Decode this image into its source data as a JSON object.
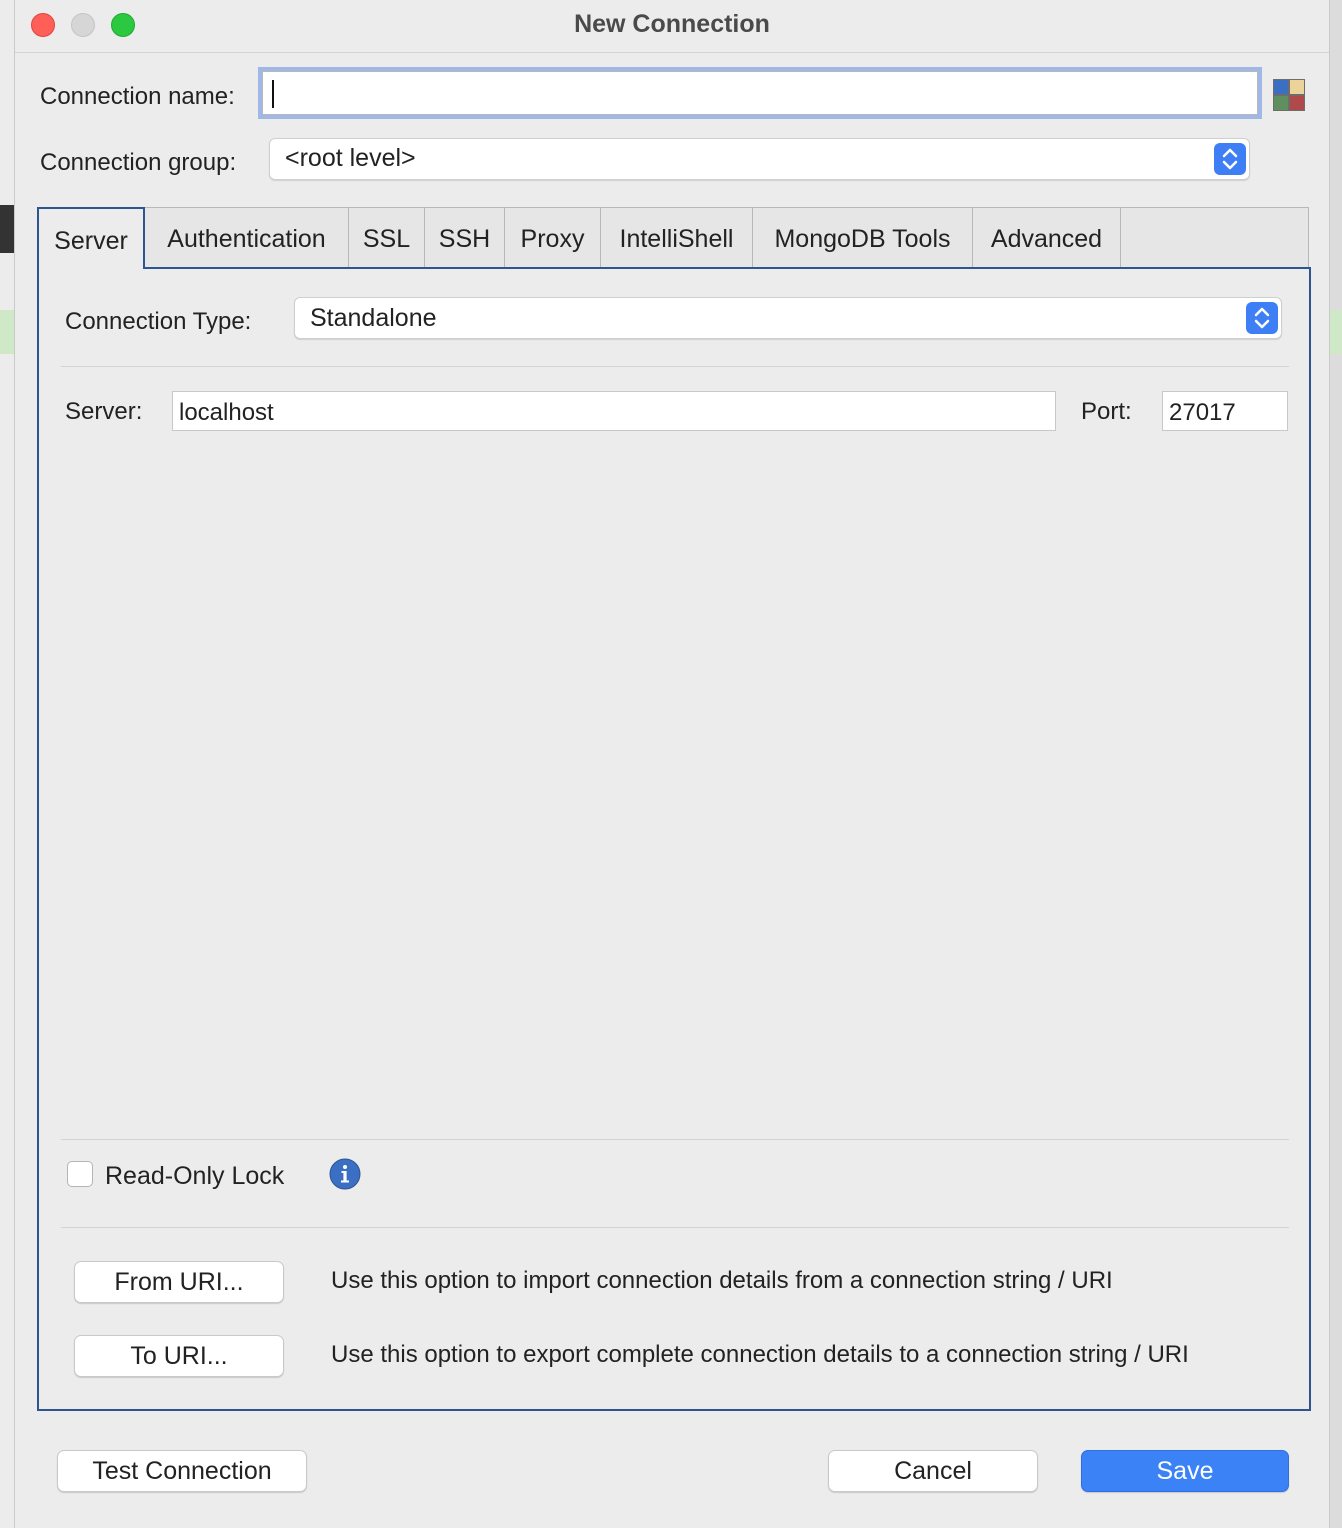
{
  "window": {
    "title": "New Connection"
  },
  "form": {
    "connection_name_label": "Connection name:",
    "connection_name_value": "",
    "connection_group_label": "Connection group:",
    "connection_group_value": "<root level>"
  },
  "tabs": [
    {
      "label": "Server",
      "active": true
    },
    {
      "label": "Authentication",
      "active": false
    },
    {
      "label": "SSL",
      "active": false
    },
    {
      "label": "SSH",
      "active": false
    },
    {
      "label": "Proxy",
      "active": false
    },
    {
      "label": "IntelliShell",
      "active": false
    },
    {
      "label": "MongoDB Tools",
      "active": false
    },
    {
      "label": "Advanced",
      "active": false
    }
  ],
  "server_tab": {
    "connection_type_label": "Connection Type:",
    "connection_type_value": "Standalone",
    "server_label": "Server:",
    "server_value": "localhost",
    "port_label": "Port:",
    "port_value": "27017",
    "read_only_label": "Read-Only Lock",
    "read_only_checked": false,
    "from_uri_button": "From URI...",
    "from_uri_desc": "Use this option to import connection details from a connection string / URI",
    "to_uri_button": "To URI...",
    "to_uri_desc": "Use this option to export complete connection details to a connection string / URI"
  },
  "footer": {
    "test_button": "Test Connection",
    "cancel_button": "Cancel",
    "save_button": "Save"
  },
  "colors": {
    "accent": "#3b82f6",
    "tab_border": "#2c5592",
    "focus_ring": "#9fb8e8"
  }
}
